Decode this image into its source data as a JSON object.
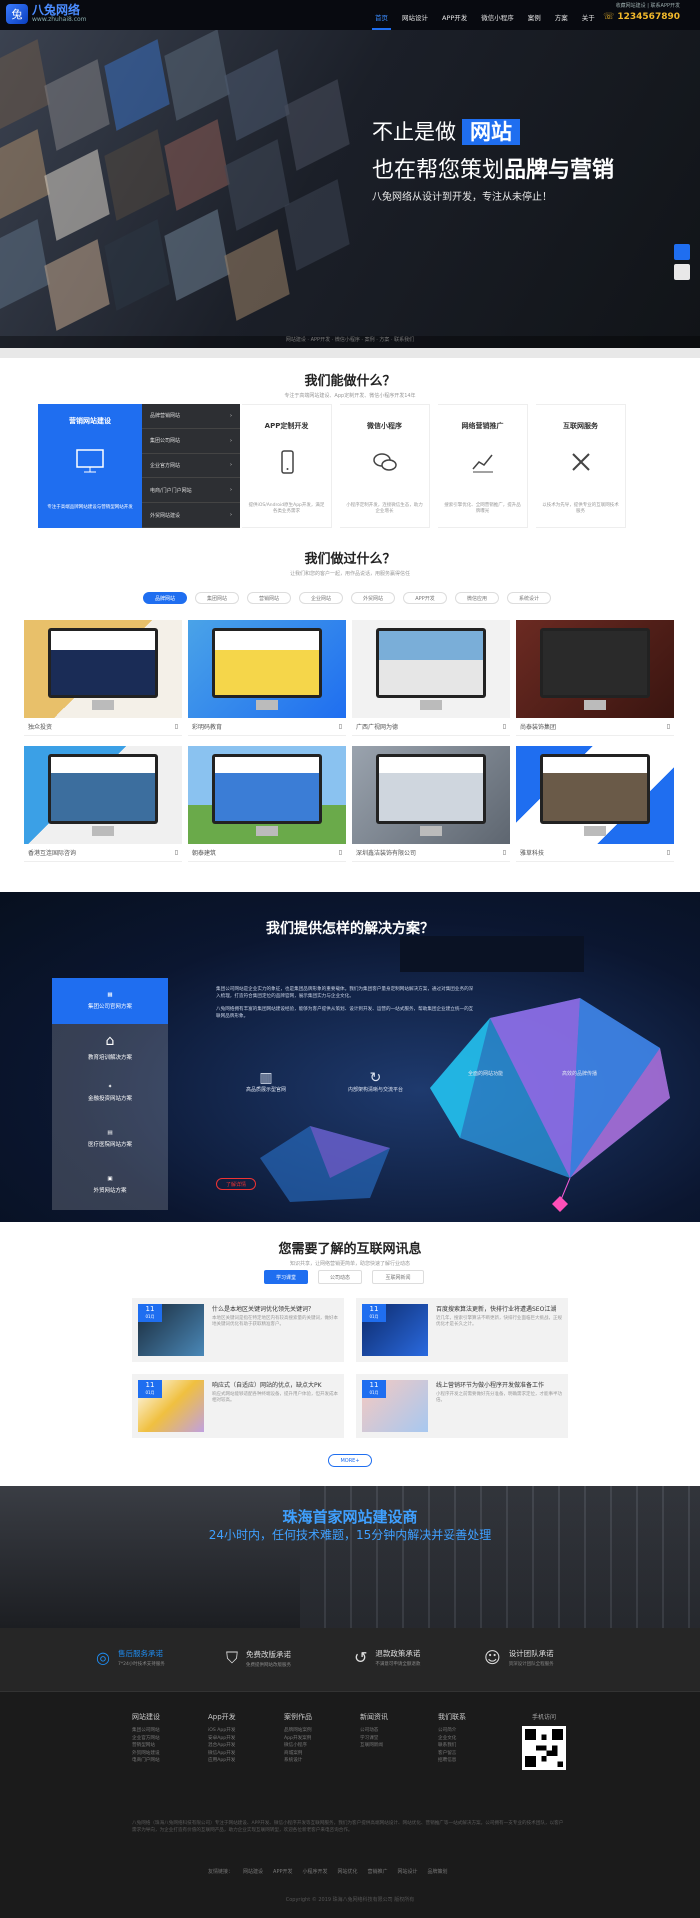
{
  "header": {
    "logo_name": "八兔网络",
    "logo_sub": "www.zhuhai8.com",
    "nav": [
      "首页",
      "网站设计",
      "APP开发",
      "微信小程序",
      "案例",
      "方案",
      "关于"
    ],
    "top_links": "收藏网站建设 | 联系APP开发",
    "phone": "1234567890"
  },
  "hero": {
    "line1a": "不止是做",
    "line1b": "网站",
    "line2a": "也在帮您策划",
    "line2b": "品牌与营销",
    "sub": "八兔网络从设计到开发，专注从未停止！",
    "bottom_nav": "网站建设 · APP开发 · 微信小程序 · 案例 · 方案 · 联系我们"
  },
  "s1": {
    "title": "我们能做什么？",
    "sub": "专注于高端网站建设、App定制开发、微信小程序开发14年",
    "left_title": "营销网站建设",
    "left_desc": "专注于高端品牌网站建设与营销型网站开发",
    "menu": [
      "品牌营销网站",
      "集团公司网站",
      "企业官方网站",
      "电商/门户门户网站",
      "外贸网站建设"
    ],
    "services": [
      {
        "title": "APP定制开发",
        "desc": "提供iOS/Android原生App开发，满足各类业务需求"
      },
      {
        "title": "微信小程序",
        "desc": "小程序定制开发，连接微信生态，助力企业增长"
      },
      {
        "title": "网络营销推广",
        "desc": "搜索引擎优化、全网营销推广，提升品牌曝光"
      },
      {
        "title": "互联网服务",
        "desc": "以技术为先导，提供专业的互联网技术服务"
      }
    ]
  },
  "s2": {
    "title": "我们做过什么？",
    "sub": "让我们和您的客户一起，用作品说话，用服务赢得信任",
    "tabs": [
      "品牌网站",
      "集团网站",
      "营销网站",
      "企业网站",
      "外贸网站",
      "APP开发",
      "微信应用",
      "系统设计"
    ],
    "cases": [
      "独众投资",
      "彩明码教育",
      "广西广视网为德",
      "尚泰装饰集团",
      "香港互连国际咨询",
      "朝泰建筑",
      "深圳鑫洁装饰有限公司",
      "雅草科技"
    ]
  },
  "s3": {
    "title": "我们提供怎样的解决方案？",
    "menu": [
      "集团公司官网方案",
      "教育培训解决方案",
      "金融投资网站方案",
      "医疗医院网站方案",
      "外贸网站方案"
    ],
    "para1": "集团公司网站是企业实力的象征，也是集团品牌形象的重要载体。我们为集团客户量身定制网站解决方案，通过对集团业务的深入梳理，打造符合集团定位的品牌官网，展示集团实力与企业文化。",
    "para2": "八兔网络拥有丰富的集团网站建设经验，能够为客户提供从策划、设计到开发、运营的一站式服务，帮助集团企业建立统一的互联网品牌形象。",
    "feat1": "高品质展示型官网",
    "feat2": "内部架构清晰与交流平台",
    "feat3": "全面的网站功能",
    "feat4": "高效的品牌传播",
    "more": "了解详情"
  },
  "s4": {
    "title": "您需要了解的互联网讯息",
    "sub": "知识共享，让网络营销更简单，助您快速了解行业动态",
    "tabs": [
      "学习课堂",
      "公司动态",
      "互联网新闻"
    ],
    "news": [
      {
        "d": "11",
        "m": "01月",
        "title": "什么是本地区关键词优化领先关键词？",
        "desc": "本地区关键词是指在特定地区内有较高搜索量的关键词，做好本地关键词优化有助于获取精准客户。"
      },
      {
        "d": "11",
        "m": "01月",
        "title": "百度搜索算法更新，快排行业将遭遇SEO江湖",
        "desc": "近几年，搜索引擎算法不断更新，快排行业面临巨大挑战，正规优化才是长久之计。"
      },
      {
        "d": "11",
        "m": "01月",
        "title": "响应式（自适应）网站的优点，缺点大PK",
        "desc": "响应式网站能够适配各种终端设备，提升用户体验，但开发成本相对较高。"
      },
      {
        "d": "11",
        "m": "01月",
        "title": "线上营销环节为做小程序开发做准备工作",
        "desc": "小程序开发之前需要做好充分准备，明确需求定位，才能事半功倍。"
      }
    ],
    "more": "MORE+"
  },
  "s5": {
    "title": "珠海首家网站建设商",
    "sub": "24小时内，任何技术难题，15分钟内解决并妥善处理"
  },
  "s6": [
    {
      "t": "售后服务承诺",
      "d": "7*24小时技术支持服务"
    },
    {
      "t": "免费改版承诺",
      "d": "免费提供网站改版服务"
    },
    {
      "t": "退款政策承诺",
      "d": "不满意可申请全额退款"
    },
    {
      "t": "设计团队承诺",
      "d": "资深设计团队全程服务"
    }
  ],
  "footer": {
    "cols": [
      {
        "h": "网站建设",
        "i": [
          "集团公司网站",
          "企业官方网站",
          "营销型网站",
          "外贸网站建设",
          "电商门户网站"
        ]
      },
      {
        "h": "App开发",
        "i": [
          "iOS App开发",
          "安卓App开发",
          "混合App开发",
          "微信App开发",
          "应用App开发"
        ]
      },
      {
        "h": "案例作品",
        "i": [
          "品牌网站案例",
          "App开发案例",
          "微信小程序",
          "商城案例",
          "系统设计"
        ]
      },
      {
        "h": "新闻资讯",
        "i": [
          "公司动态",
          "学习课堂",
          "互联网新闻"
        ]
      },
      {
        "h": "我们联系",
        "i": [
          "公司简介",
          "企业文化",
          "联系我们",
          "客户留言",
          "招聘信息"
        ]
      }
    ],
    "qr_title": "手机访问",
    "para": "八兔网络（珠海八兔网络科技有限公司）专注于网站建设、APP开发、微信小程序开发等互联网服务，我们为客户提供高端网站设计、网站优化、营销推广等一站式解决方案。公司拥有一支专业的技术团队，以客户需求为导向，为企业打造有价值的互联网产品，助力企业实现互联网转型，欢迎各位新老客户来电咨询合作。",
    "links_label": "友情链接：",
    "links": [
      "网站建设",
      "APP开发",
      "小程序开发",
      "网站优化",
      "营销推广",
      "网站设计",
      "品牌策划"
    ],
    "copy": "Copyright © 2019 珠海八兔网络科技有限公司 版权所有"
  }
}
